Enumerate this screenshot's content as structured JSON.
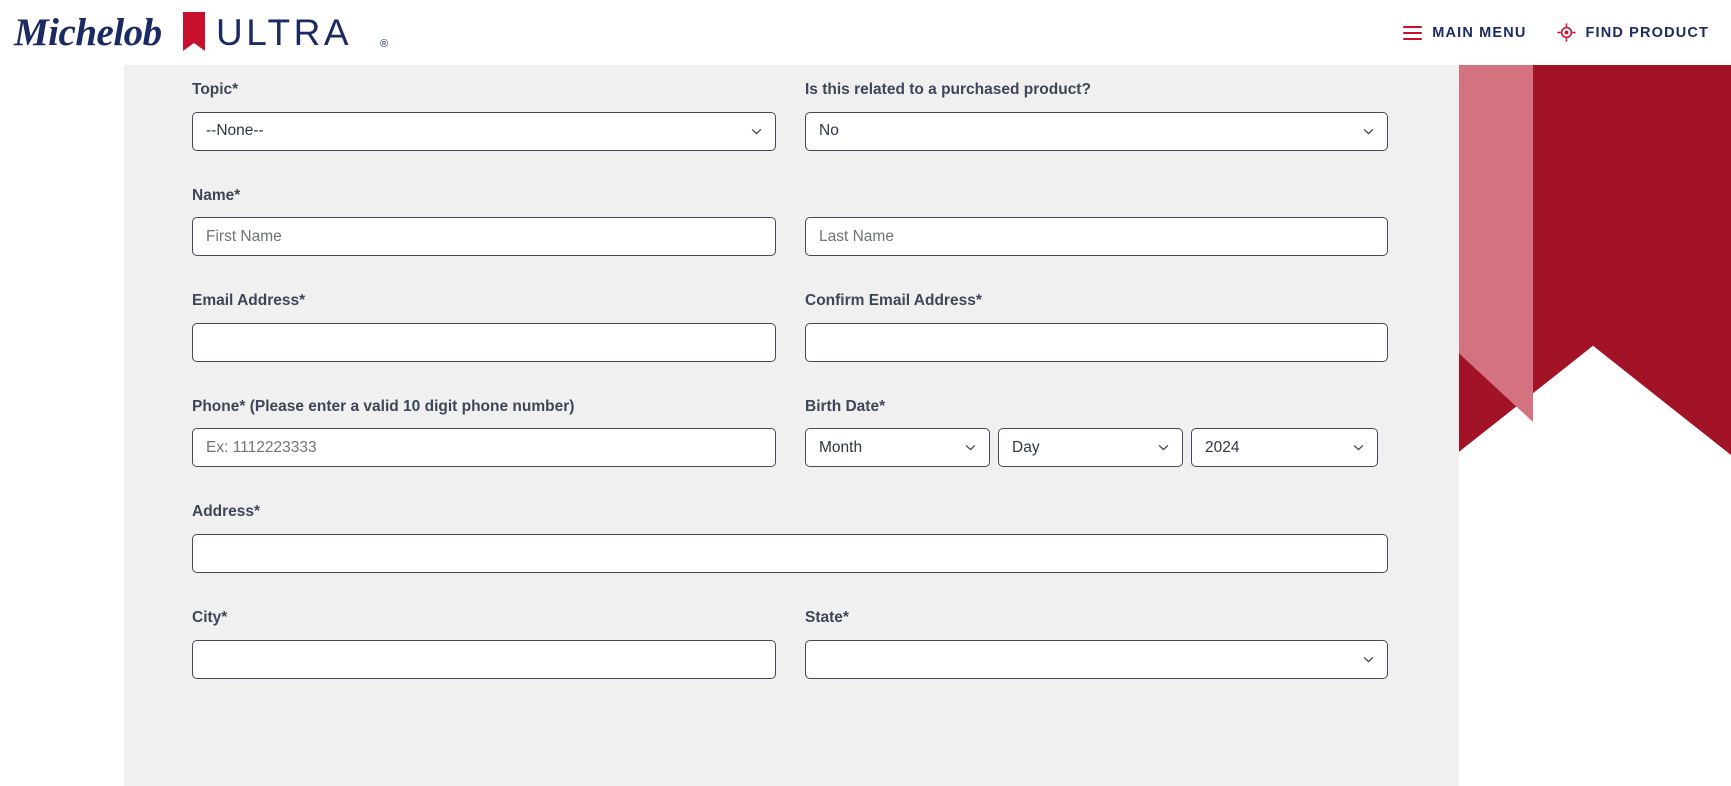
{
  "brand": {
    "logo_script_text": "Michelob",
    "logo_block_text": "ULTRA",
    "navy": "#1b2a63",
    "red": "#c8102e",
    "crimson": "#a21328",
    "rose": "#d4737f"
  },
  "header": {
    "nav": [
      {
        "label": "MAIN MENU",
        "icon": "hamburger-icon"
      },
      {
        "label": "FIND PRODUCT",
        "icon": "target-icon"
      }
    ]
  },
  "form": {
    "fields": {
      "topic": {
        "label": "Topic*",
        "value": "--None--",
        "type": "select"
      },
      "purchased_product": {
        "label": "Is this related to a purchased product?",
        "value": "No",
        "type": "select"
      },
      "name": {
        "label": "Name*",
        "first_placeholder": "First Name",
        "first_value": "",
        "last_placeholder": "Last Name",
        "last_value": ""
      },
      "email": {
        "label": "Email Address*",
        "value": "",
        "placeholder": ""
      },
      "confirm_email": {
        "label": "Confirm Email Address*",
        "value": "",
        "placeholder": ""
      },
      "phone": {
        "label": "Phone* (Please enter a valid 10 digit phone number)",
        "placeholder": "Ex: 1112223333",
        "value": ""
      },
      "birth_date": {
        "label": "Birth Date*",
        "month_value": "Month",
        "day_value": "Day",
        "year_value": "2024"
      },
      "address": {
        "label": "Address*",
        "value": "",
        "placeholder": ""
      },
      "city": {
        "label": "City*",
        "value": "",
        "placeholder": ""
      },
      "state": {
        "label": "State*",
        "value": "",
        "type": "select"
      }
    }
  }
}
